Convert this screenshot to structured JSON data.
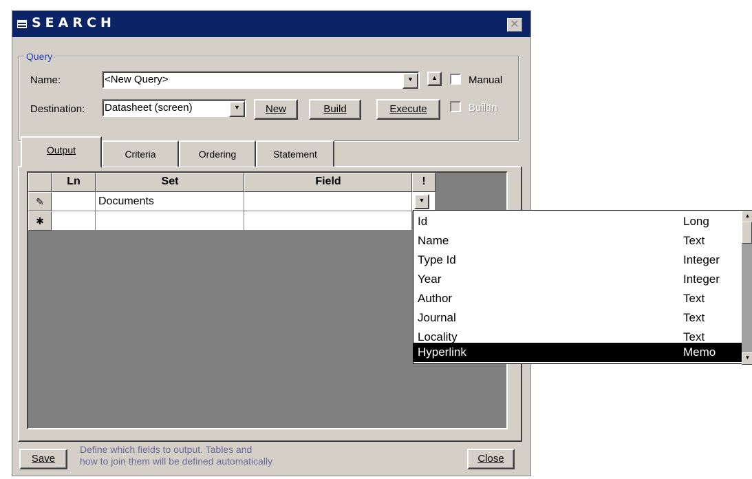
{
  "window": {
    "title": "SEARCH",
    "close_symbol": "✕"
  },
  "query": {
    "legend": "Query",
    "name_label": "Name:",
    "name_value": "<New Query>",
    "destination_label": "Destination:",
    "destination_value": "Datasheet (screen)",
    "manual_label": "Manual",
    "builtin_label": "BuiltIn",
    "buttons": {
      "new": "New",
      "build": "Build",
      "execute": "Execute"
    }
  },
  "tabs": [
    {
      "label": "Output",
      "active": true
    },
    {
      "label": "Criteria"
    },
    {
      "label": "Ordering"
    },
    {
      "label": "Statement"
    }
  ],
  "grid": {
    "headers": {
      "ln": "Ln",
      "set": "Set",
      "field": "Field",
      "flag": "!"
    },
    "rows": [
      {
        "selector": "✎",
        "ln": "",
        "set": "Documents",
        "field": ""
      },
      {
        "selector": "✱",
        "ln": "",
        "set": "",
        "field": ""
      }
    ]
  },
  "dropdown": {
    "items": [
      {
        "name": "Id",
        "type": "Long"
      },
      {
        "name": "Name",
        "type": "Text"
      },
      {
        "name": "Type Id",
        "type": "Integer"
      },
      {
        "name": "Year",
        "type": "Integer"
      },
      {
        "name": "Author",
        "type": "Text"
      },
      {
        "name": "Journal",
        "type": "Text"
      },
      {
        "name": "Locality",
        "type": "Text"
      },
      {
        "name": "Hyperlink",
        "type": "Memo",
        "highlighted": true
      }
    ]
  },
  "footer": {
    "save": "Save",
    "close": "Close",
    "hint_line1": "Define which fields to output. Tables and",
    "hint_line2": "how to join them will be defined automatically"
  }
}
